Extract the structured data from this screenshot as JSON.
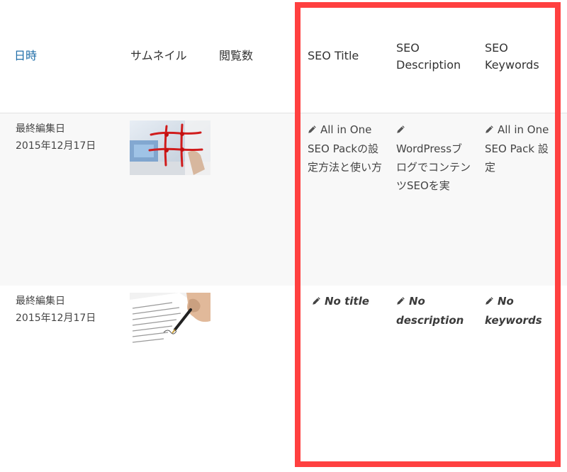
{
  "columns": {
    "date": "日時",
    "thumbnail": "サムネイル",
    "views": "閲覧数",
    "seo_title": "SEO Title",
    "seo_description": "SEO\nDescription",
    "seo_keywords": "SEO\nKeywords"
  },
  "rows": [
    {
      "date_label": "最終編集日",
      "date": "2015年12月17日",
      "thumbnail_icon": "seo-graph-thumbnail",
      "seo_title": "All in One SEO Packの設定方法と使い方",
      "seo_description": "WordPressブログでコンテンツSEOを実",
      "seo_keywords": "All in One SEO Pack 設定"
    },
    {
      "date_label": "最終編集日",
      "date": "2015年12月17日",
      "thumbnail_icon": "signing-document-thumbnail",
      "seo_title": "No title",
      "seo_description": "No description",
      "seo_keywords": "No keywords"
    }
  ],
  "colors": {
    "link": "#1f6ea8",
    "highlight": "#ff4040",
    "row_alt": "#f8f8f8"
  },
  "icons": {
    "edit": "pencil-icon"
  }
}
